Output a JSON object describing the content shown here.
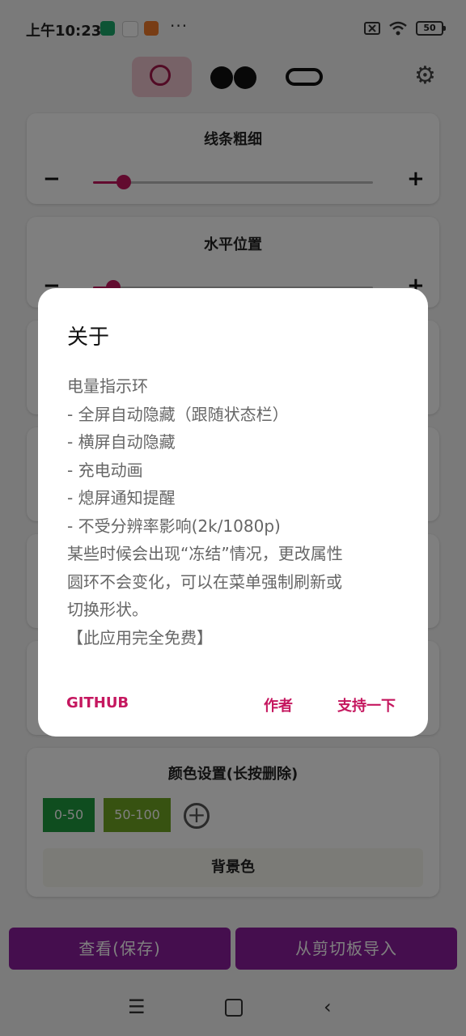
{
  "status_bar": {
    "time": "上午10:23",
    "more": "···",
    "battery": "50"
  },
  "toolbar": {
    "shapes": [
      "ring-shape-icon",
      "dots-shape-icon",
      "pill-shape-icon"
    ],
    "settings_icon": "gear-icon"
  },
  "cards": {
    "line_width": {
      "title": "线条粗细",
      "value": 0.1
    },
    "horizontal_position": {
      "title": "水平位置",
      "value": 0.07
    }
  },
  "color_settings": {
    "title": "颜色设置(长按删除)",
    "chips": [
      {
        "label": "0-50",
        "color": "#1f9a3f"
      },
      {
        "label": "50-100",
        "color": "#6fa422"
      }
    ],
    "background_label": "背景色"
  },
  "bottom": {
    "view_save": "查看(保存)",
    "import_clipboard": "从剪切板导入"
  },
  "dialog": {
    "title": "关于",
    "lines": [
      "电量指示环",
      "- 全屏自动隐藏（跟随状态栏）",
      "- 横屏自动隐藏",
      "- 充电动画",
      "- 熄屏通知提醒",
      "- 不受分辨率影响(2k/1080p)",
      "某些时候会出现“冻结”情况，更改属性",
      "圆环不会变化，可以在菜单强制刷新或",
      "切换形状。",
      "【此应用完全免费】"
    ],
    "buttons": {
      "github": "GITHUB",
      "author": "作者",
      "support": "支持一下"
    }
  },
  "colors": {
    "accent": "#c5175f",
    "primary": "#8b1c9c"
  }
}
